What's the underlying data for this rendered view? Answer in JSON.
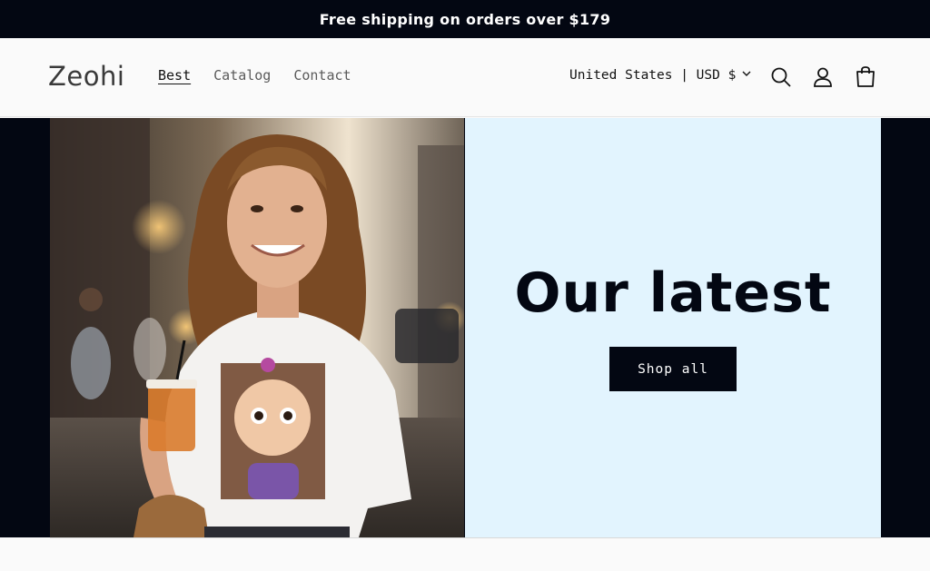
{
  "announcement": "Free shipping on orders over $179",
  "header": {
    "logo": "Zeohi",
    "nav": [
      {
        "label": "Best",
        "active": true
      },
      {
        "label": "Catalog",
        "active": false
      },
      {
        "label": "Contact",
        "active": false
      }
    ],
    "locale": "United States | USD $",
    "icons": [
      "chevron-down-icon",
      "search-icon",
      "account-icon",
      "cart-icon"
    ]
  },
  "hero": {
    "image_alt": "Smiling woman holding an iced coffee wearing a white t-shirt with a cartoon girl print",
    "title": "Our latest",
    "button_label": "Shop all"
  },
  "colors": {
    "dark": "#030712",
    "panel": "#e2f4fe",
    "page": "#fafafa"
  }
}
